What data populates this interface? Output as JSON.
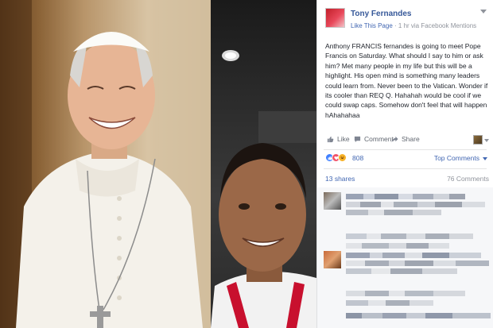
{
  "post": {
    "author": "Tony Fernandes",
    "meta_like_page": "Like This Page",
    "meta_separator": " · ",
    "meta_time": "1 hr via Facebook Mentions",
    "text": "Anthony FRANCIS fernandes is going to meet Pope Francis on Saturday. What should I say to him or ask him? Met many people in my life but this will be a highlight. His open mind is something many leaders could learn from. Never been to the Vatican. Wonder if its cooler than REQ Q. Hahahah would be cool if we could swap caps. Somehow don't feel that will happen hAhahahaa"
  },
  "actions": {
    "like": "Like",
    "comment": "Comment",
    "share": "Share"
  },
  "icons": {
    "like": "thumbs-up-icon",
    "comment": "speech-bubble-icon",
    "share": "share-arrow-icon",
    "reactions": [
      "like-reaction-icon",
      "love-reaction-icon",
      "haha-reaction-icon"
    ]
  },
  "stats": {
    "reaction_count": "808",
    "top_comments": "Top Comments",
    "shares": "13 shares",
    "comments": "76 Comments"
  },
  "colors": {
    "link_blue": "#4267b2",
    "author_blue": "#365899",
    "muted_gray": "#90949c",
    "like_blue": "#4080ff",
    "love_red": "#f25268",
    "haha_yellow": "#f7b125"
  }
}
